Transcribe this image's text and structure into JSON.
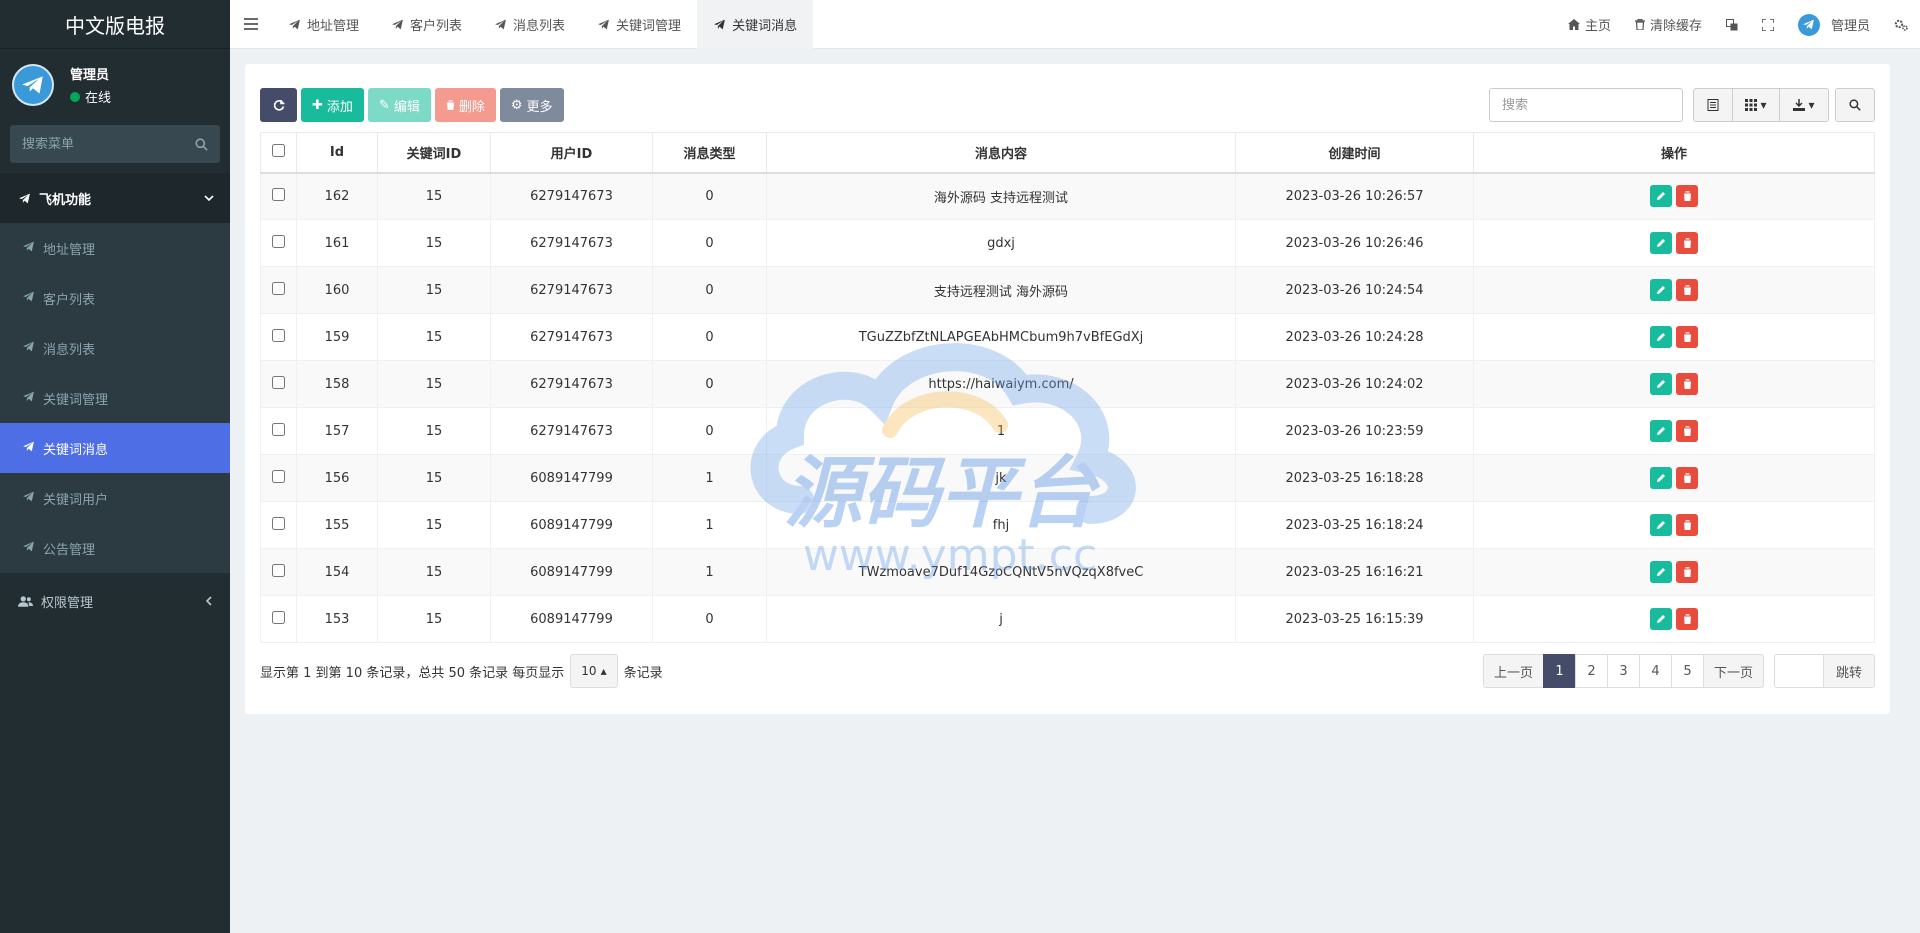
{
  "app": {
    "brand": "中文版电报"
  },
  "user": {
    "name": "管理员",
    "status": "在线"
  },
  "sidebar": {
    "search_placeholder": "搜索菜单",
    "group1": "飞机功能",
    "items": [
      {
        "label": "地址管理"
      },
      {
        "label": "客户列表"
      },
      {
        "label": "消息列表"
      },
      {
        "label": "关键词管理"
      },
      {
        "label": "关键词消息"
      },
      {
        "label": "关键词用户"
      },
      {
        "label": "公告管理"
      }
    ],
    "group2": "权限管理"
  },
  "topnav": {
    "tabs": [
      {
        "label": "地址管理"
      },
      {
        "label": "客户列表"
      },
      {
        "label": "消息列表"
      },
      {
        "label": "关键词管理"
      },
      {
        "label": "关键词消息"
      }
    ],
    "home": "主页",
    "clear_cache": "清除缓存",
    "admin": "管理员"
  },
  "toolbar": {
    "add": "添加",
    "edit": "编辑",
    "delete": "删除",
    "more": "更多",
    "search_placeholder": "搜索"
  },
  "table": {
    "headers": [
      "Id",
      "关键词ID",
      "用户ID",
      "消息类型",
      "消息内容",
      "创建时间",
      "操作"
    ],
    "rows": [
      {
        "id": "162",
        "kw": "15",
        "uid": "6279147673",
        "type": "0",
        "content": "海外源码 支持远程测试",
        "time": "2023-03-26 10:26:57"
      },
      {
        "id": "161",
        "kw": "15",
        "uid": "6279147673",
        "type": "0",
        "content": "gdxj",
        "time": "2023-03-26 10:26:46"
      },
      {
        "id": "160",
        "kw": "15",
        "uid": "6279147673",
        "type": "0",
        "content": "支持远程测试 海外源码",
        "time": "2023-03-26 10:24:54"
      },
      {
        "id": "159",
        "kw": "15",
        "uid": "6279147673",
        "type": "0",
        "content": "TGuZZbfZtNLAPGEAbHMCbum9h7vBfEGdXj",
        "time": "2023-03-26 10:24:28"
      },
      {
        "id": "158",
        "kw": "15",
        "uid": "6279147673",
        "type": "0",
        "content": "https://haiwaiym.com/",
        "time": "2023-03-26 10:24:02"
      },
      {
        "id": "157",
        "kw": "15",
        "uid": "6279147673",
        "type": "0",
        "content": "1",
        "time": "2023-03-26 10:23:59"
      },
      {
        "id": "156",
        "kw": "15",
        "uid": "6089147799",
        "type": "1",
        "content": "jk",
        "time": "2023-03-25 16:18:28"
      },
      {
        "id": "155",
        "kw": "15",
        "uid": "6089147799",
        "type": "1",
        "content": "fhj",
        "time": "2023-03-25 16:18:24"
      },
      {
        "id": "154",
        "kw": "15",
        "uid": "6089147799",
        "type": "1",
        "content": "TWzmoave7Duf14GzoCQNtV5nVQzqX8fveC",
        "time": "2023-03-25 16:16:21"
      },
      {
        "id": "153",
        "kw": "15",
        "uid": "6089147799",
        "type": "0",
        "content": "j",
        "time": "2023-03-25 16:15:39"
      }
    ]
  },
  "footer": {
    "info_prefix": "显示第 1 到第 10 条记录，总共 50 条记录 每页显示",
    "page_size": "10",
    "info_suffix": "条记录",
    "prev": "上一页",
    "pages": [
      "1",
      "2",
      "3",
      "4",
      "5"
    ],
    "next": "下一页",
    "jump": "跳转"
  },
  "watermark": {
    "text": "源码平台",
    "url": "www.ympt.cc"
  },
  "colors": {
    "sidebar": "#222d32",
    "active": "#4e6ee5",
    "add": "#18bc9c",
    "delete": "#e74c3c",
    "primary_dark": "#444c69"
  }
}
